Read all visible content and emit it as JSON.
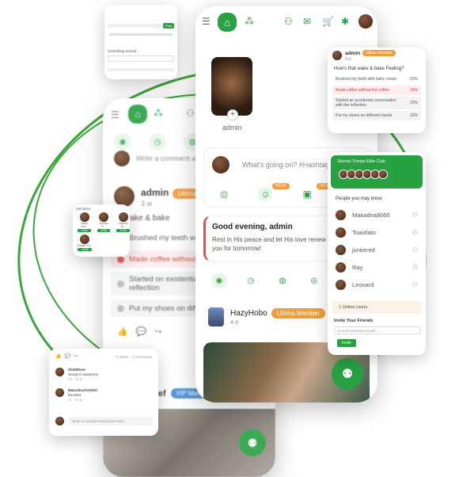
{
  "brand": {
    "accent": "#27a142",
    "badge": "#f39a3a"
  },
  "nav": {
    "home_icon": "home-icon",
    "menu_icon": "hamburger-icon",
    "icons": [
      "apps-icon",
      "friends-icon",
      "messages-icon",
      "cart-icon",
      "notifications-icon"
    ]
  },
  "profile": {
    "name": "admin"
  },
  "composer": {
    "placeholder": "What's going on? #Hashtag..",
    "new1": "NEW",
    "new2": "NEW"
  },
  "greeting": {
    "title": "Good evening, admin",
    "body": "Rest in His peace and let His love renew you for tomorrow!"
  },
  "feed_post": {
    "user": "HazyHobo",
    "badge": "Ultima Member",
    "time": "4 d"
  },
  "back_post": {
    "comment_placeholder": "Write a comment and...",
    "user": "admin",
    "badge": "Ultima Me",
    "time": "3 w",
    "question": "s that wake & bake",
    "options": [
      {
        "text": "Brushed my teeth with",
        "style": "plain"
      },
      {
        "text": "Made coffee without th",
        "style": "red"
      },
      {
        "text": "Started on existential c reflection",
        "style": "gray"
      },
      {
        "text": "Put my shoes on differe",
        "style": "gray"
      }
    ],
    "second_user_suffix": "hief",
    "second_badge": "VIP Mem"
  },
  "poll_card": {
    "user": "admin",
    "badge": "Ultima Member",
    "time": "3 w",
    "question": "How's that wake & bake Feeling?",
    "options": [
      {
        "text": "Brushed my teeth with bake cream",
        "pct": "23%",
        "style": "plain"
      },
      {
        "text": "Made coffee without the coffee",
        "pct": "39%",
        "style": "red"
      },
      {
        "text": "Started an accidental conversation with the reflection",
        "pct": "23%",
        "style": "gray"
      },
      {
        "text": "Put my shoes on different hands",
        "pct": "15%",
        "style": "gray"
      }
    ]
  },
  "group_card": {
    "title": "Stoned Troops Elite Club",
    "people_title": "People you may know",
    "people": [
      "Makadna8060",
      "Toastlato",
      "junkered",
      "Ray",
      "Leonard"
    ],
    "online": "1 Online Users",
    "invite_title": "Invite Your Friends",
    "invite_placeholder": "E-mail (unrelated email)",
    "invite_button": "Invite"
  },
  "comments_card": {
    "reactions": "2 Share · 2 Comments",
    "comments": [
      {
        "user": "SheltDiver",
        "text": "Snoop is awesome",
        "meta": "Lk · 11 w"
      },
      {
        "user": "MalcolmJASONO",
        "text": "the best",
        "meta": "Lk · 11 w"
      }
    ],
    "placeholder": "Write a comment and press enter"
  },
  "members_card": {
    "title": "Members",
    "members": [
      "Jacob Kru...",
      "Dunkin E...",
      "Cheech B...",
      "Robert Fu..."
    ],
    "tag": "JOIN"
  },
  "mini_card": {
    "title": "Something stoned",
    "button": "Post"
  }
}
